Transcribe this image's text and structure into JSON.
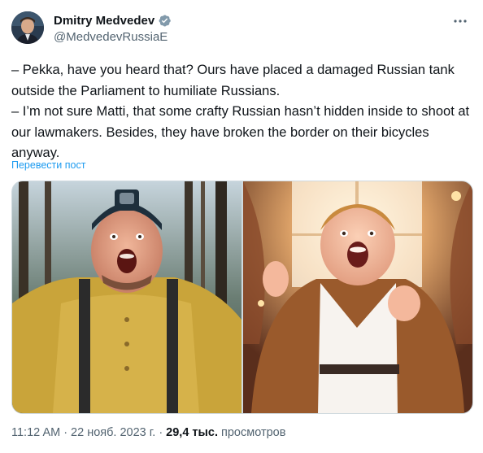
{
  "author": {
    "display_name": "Dmitry Medvedev",
    "handle": "@MedvedevRussiaE",
    "verified_badge": "verified-badge-icon"
  },
  "tweet": {
    "text": "– Pekka, have you heard that? Ours have placed a damaged Russian tank outside the Parliament to humiliate Russians.\n– I’m not sure Matti, that some crafty Russian hasn’t hidden inside to shoot at our lawmakers. Besides, they have broken the border on their bicycles anyway.",
    "translate_label": "Перевести пост"
  },
  "media": {
    "photos": [
      {
        "name": "photo-man-in-helmet"
      },
      {
        "name": "photo-man-in-brown-jacket"
      }
    ]
  },
  "meta": {
    "time": "11:12 AM",
    "separator1": "·",
    "date": "22 нояб. 2023 г.",
    "separator2": "·",
    "views_count": "29,4 тыс.",
    "views_label": "просмотров"
  },
  "colors": {
    "accent": "#1d9bf0",
    "text": "#0f1419",
    "secondary": "#536471"
  }
}
